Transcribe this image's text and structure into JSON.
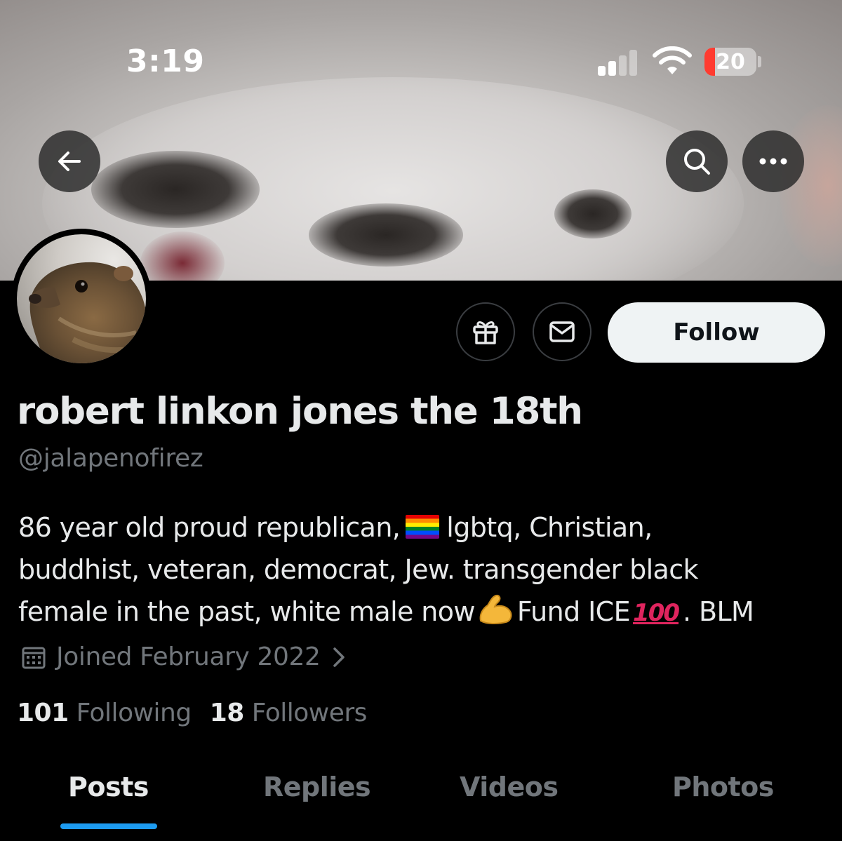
{
  "status_bar": {
    "time": "3:19",
    "battery_level": "20",
    "battery_fraction": 0.2,
    "signal_bars_active": 2,
    "signal_bars_total": 4
  },
  "header": {
    "back_icon": "arrow-left-icon",
    "search_icon": "search-icon",
    "more_icon": "more-horizontal-icon"
  },
  "actions": {
    "gift_icon": "gift-icon",
    "message_icon": "envelope-icon",
    "follow_label": "Follow"
  },
  "profile": {
    "display_name": "robert linkon jones the 18th",
    "handle": "@jalapenofirez",
    "bio": {
      "line1_a": "86 year old proud republican,",
      "line1_b": "lgbtq, Christian,",
      "line2": "buddhist, veteran, democrat, Jew. transgender black",
      "line3_a": "female in the past, white male now",
      "line3_b": "Fund ICE",
      "line3_c": ". BLM",
      "hundred": "100"
    },
    "joined": "Joined February 2022",
    "following_count": "101",
    "following_label": "Following",
    "followers_count": "18",
    "followers_label": "Followers"
  },
  "tabs": [
    {
      "label": "Posts",
      "active": true
    },
    {
      "label": "Replies",
      "active": false
    },
    {
      "label": "Videos",
      "active": false
    },
    {
      "label": "Photos",
      "active": false
    }
  ],
  "colors": {
    "background": "#000000",
    "text_primary": "#e7e9ea",
    "text_secondary": "#71767b",
    "accent": "#1d9bf0",
    "follow_button_bg": "#eff3f4",
    "battery_low": "#ff3b30"
  }
}
